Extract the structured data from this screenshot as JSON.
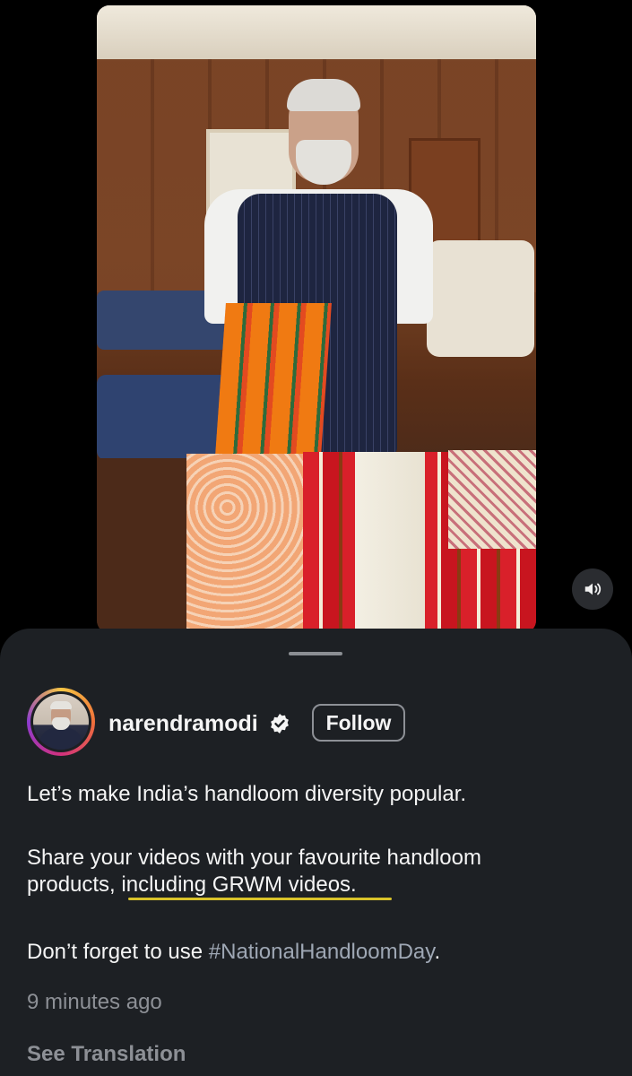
{
  "post": {
    "username": "narendramodi",
    "verified": true,
    "follow_label": "Follow",
    "caption": {
      "line1": "Let’s make India’s handloom diversity popular.",
      "line2": "Share your videos with your favourite handloom",
      "line3_prefix": "products, ",
      "line3_highlight": "including GRWM videos.",
      "line4_prefix": "Don’t forget to use ",
      "hashtag": "#NationalHandloomDay",
      "line4_suffix": "."
    },
    "timestamp": "9 minutes ago",
    "see_translation": "See Translation"
  },
  "media": {
    "type": "video",
    "mute_icon": "speaker-icon"
  },
  "colors": {
    "sheet_background": "#1d2024",
    "highlight_underline": "#d9c32a",
    "secondary_text": "#8d9096",
    "hashtag": "#9ea7b4"
  }
}
